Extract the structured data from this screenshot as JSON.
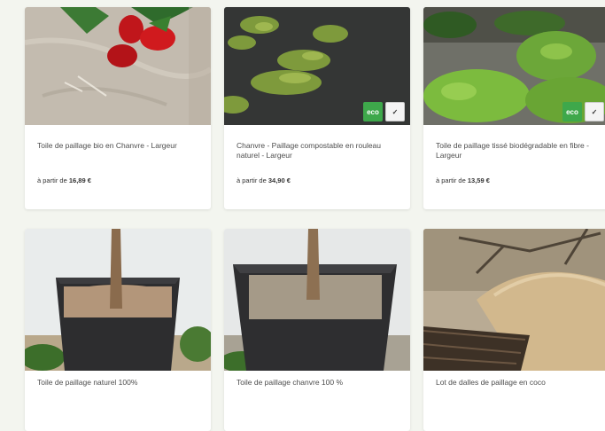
{
  "products": [
    {
      "title": "Toile de paillage bio en Chanvre - Largeur",
      "price_prefix": "à partir de",
      "price": "16,89 €",
      "badges": []
    },
    {
      "title": "Chanvre - Paillage compostable en rouleau naturel - Largeur",
      "price_prefix": "à partir de",
      "price": "34,90 €",
      "badges": [
        "eco",
        "check"
      ]
    },
    {
      "title": "Toile de paillage tissé biodégradable en fibre - Largeur",
      "price_prefix": "à partir de",
      "price": "13,59 €",
      "badges": [
        "eco",
        "check"
      ]
    },
    {
      "title": "Toile de paillage naturel 100%",
      "price_prefix": "",
      "price": "",
      "badges": []
    },
    {
      "title": "Toile de paillage chanvre 100 %",
      "price_prefix": "",
      "price": "",
      "badges": []
    },
    {
      "title": "Lot de dalles de paillage en coco",
      "price_prefix": "",
      "price": "",
      "badges": []
    }
  ],
  "badge_labels": {
    "eco": "eco",
    "check": "✓"
  },
  "colors": {
    "eco_badge": "#3ea84b",
    "card_bg": "#ffffff",
    "page_bg": "#f3f5ef"
  }
}
